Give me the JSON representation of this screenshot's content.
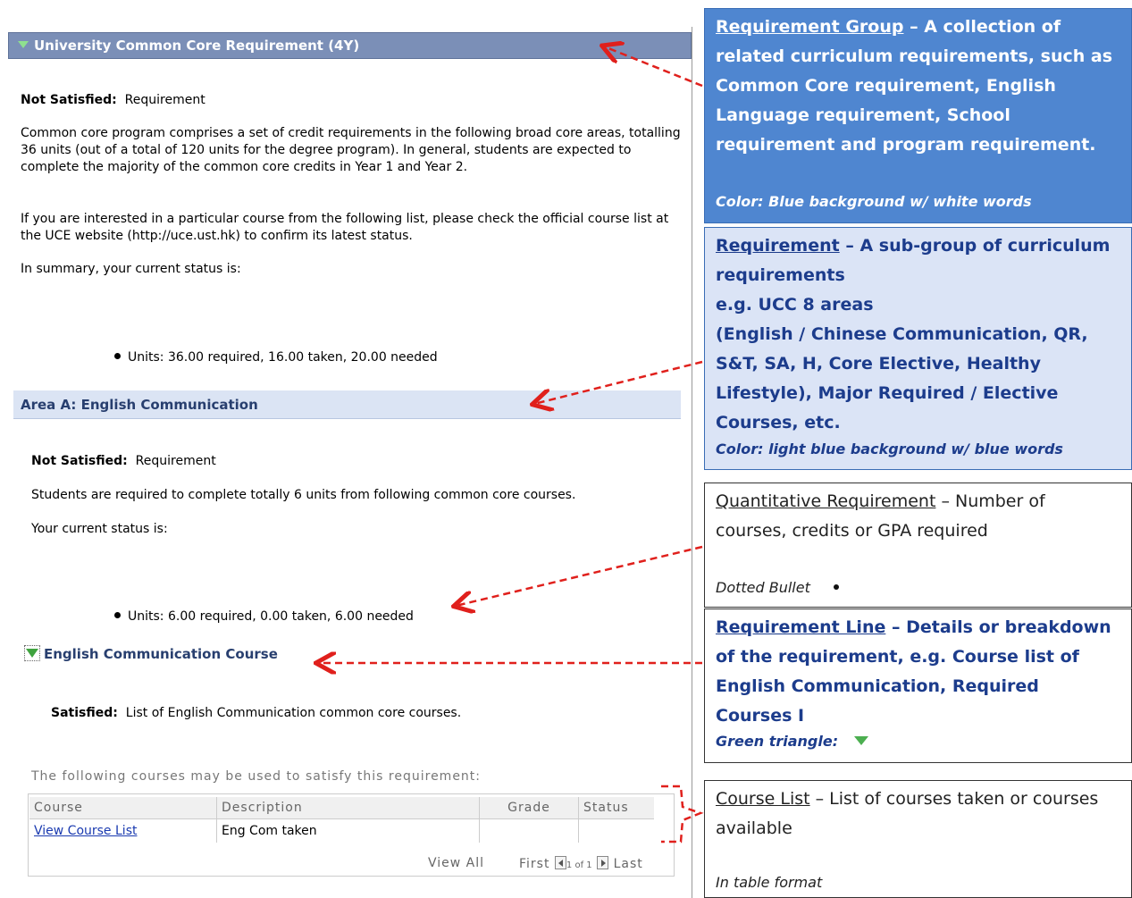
{
  "report": {
    "group_title": "University Common Core Requirement (4Y)",
    "status_label": "Not Satisfied:",
    "status_value": "Requirement",
    "desc_1": "Common core program comprises a set of credit requirements in the following broad core areas, totalling 36 units (out of a total of 120 units for the degree program). In general, students are expected to complete the majority of the common core credits in Year 1 and Year 2.",
    "desc_2": "If you are interested in a particular course from the following list, please check the official course list at the UCE website (http://uce.ust.hk) to confirm its latest status.",
    "summary": "In summary, your current status is:",
    "units": "Units: 36.00 required, 16.00 taken, 20.00 needed",
    "area": {
      "title": "Area A: English Communication",
      "status_label": "Not Satisfied:",
      "status_value": "Requirement",
      "desc": "Students are required to complete totally 6 units from following common core courses.",
      "summary": "Your current status is:",
      "units": "Units: 6.00 required, 0.00 taken, 6.00 needed"
    },
    "line": {
      "title": "English Communication Course",
      "status_label": "Satisfied:",
      "status_value": "List of English Communication common core courses.",
      "courses_intro": "The following courses may be used to satisfy this requirement:"
    },
    "table": {
      "headers": [
        "Course",
        "Description",
        "Grade",
        "Status"
      ],
      "rows": [
        {
          "course": "View Course List",
          "description": "Eng Com taken",
          "grade": "",
          "status": ""
        }
      ]
    },
    "nav": {
      "view_all": "View All",
      "first": "First",
      "page": "1 of 1",
      "last": "Last"
    }
  },
  "legend": {
    "group": {
      "term": "Requirement Group",
      "text": " – A collection of related curriculum requirements, such as Common Core requirement, English Language requirement, School requirement and program requirement.",
      "note": "Color: Blue background w/ white words"
    },
    "requirement": {
      "term": "Requirement",
      "text": " – A sub-group of curriculum requirements",
      "line2": "e.g. UCC 8 areas",
      "line3": "(English / Chinese Communication, QR, S&T, SA, H, Core Elective, Healthy Lifestyle), Major Required / Elective Courses, etc.",
      "note": "Color: light blue background w/ blue words"
    },
    "quantitative": {
      "term": "Quantitative Requirement",
      "text": " – Number of courses, credits or GPA required",
      "note": "Dotted Bullet"
    },
    "line": {
      "term": "Requirement Line",
      "text": " – Details or breakdown of the requirement, e.g. Course list of English Communication, Required Courses I",
      "note": "Green triangle:"
    },
    "course_list": {
      "term": "Course List",
      "text": " – List of courses taken or courses available",
      "note": "In table format"
    }
  },
  "colors": {
    "group_header_bg": "#7b8fb7",
    "requirement_header_bg": "#dbe4f4",
    "legend_group_bg": "#4f86d0",
    "legend_requirement_bg": "#dbe4f6",
    "arrow": "#e0201c",
    "green_triangle": "#4caf50"
  }
}
